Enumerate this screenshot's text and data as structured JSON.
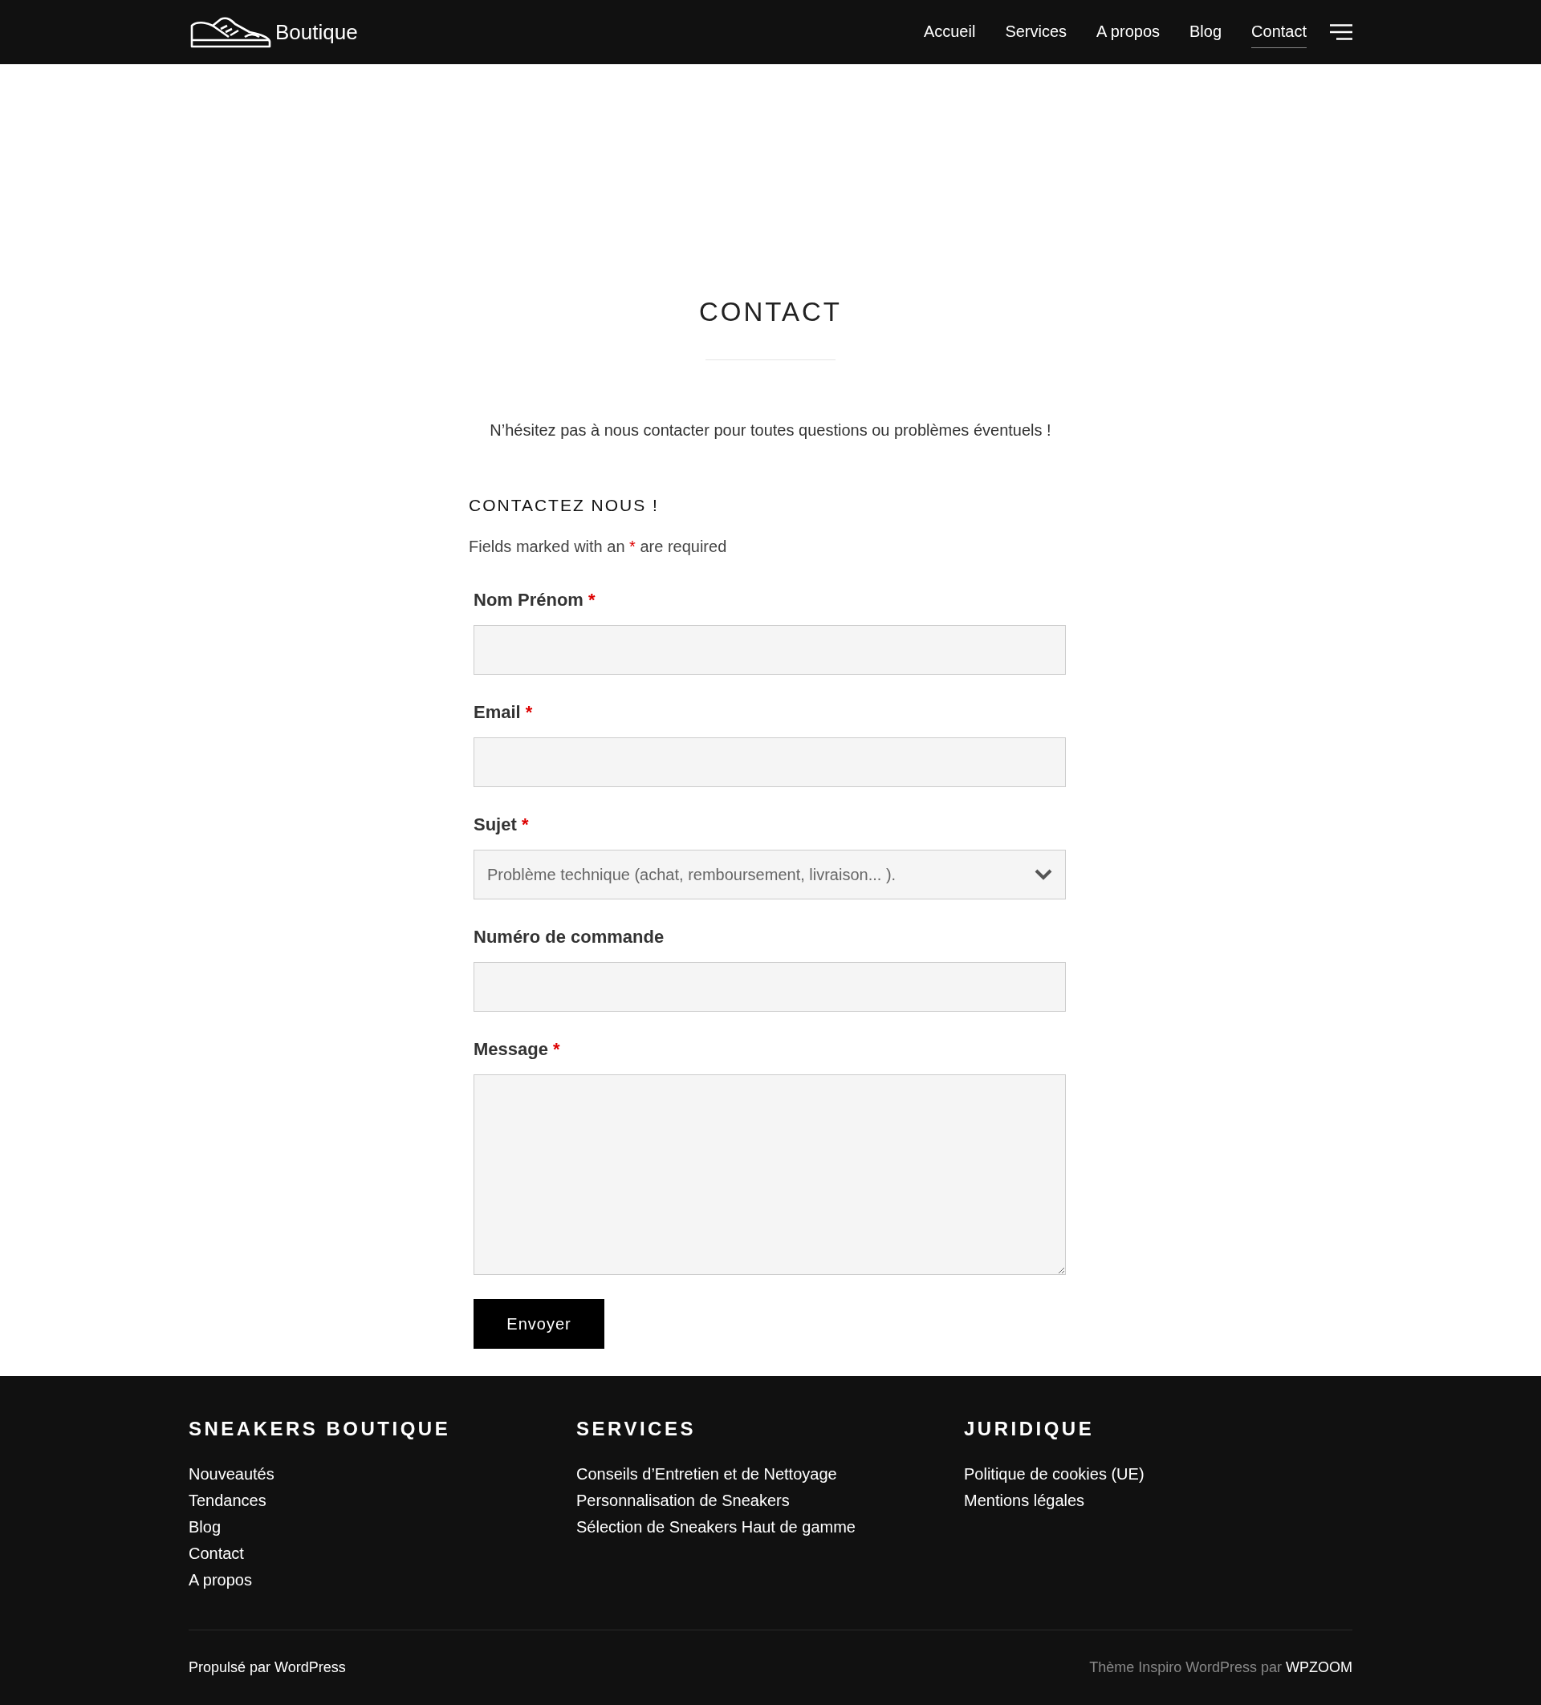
{
  "header": {
    "brand": "Boutique",
    "nav": [
      {
        "label": "Accueil",
        "selected": false
      },
      {
        "label": "Services",
        "selected": false
      },
      {
        "label": "A propos",
        "selected": false
      },
      {
        "label": "Blog",
        "selected": false
      },
      {
        "label": "Contact",
        "selected": true
      }
    ]
  },
  "page": {
    "title": "CONTACT",
    "intro": "N’hésitez pas à nous contacter pour toutes questions ou problèmes éventuels !"
  },
  "form": {
    "title": "CONTACTEZ NOUS !",
    "required_note": {
      "before": "Fields marked with an",
      "mark": "*",
      "after": "are required"
    },
    "fields": [
      {
        "kind": "text",
        "label": "Nom Prénom",
        "required": true
      },
      {
        "kind": "text",
        "label": "Email",
        "required": true
      },
      {
        "kind": "select",
        "label": "Sujet",
        "required": true,
        "value": "Problème technique (achat, remboursement, livraison... )."
      },
      {
        "kind": "text",
        "label": "Numéro de commande",
        "required": false
      },
      {
        "kind": "textarea",
        "label": "Message",
        "required": true
      }
    ],
    "submit": "Envoyer"
  },
  "footer": {
    "columns": [
      {
        "title": "SNEAKERS BOUTIQUE",
        "links": [
          "Nouveautés",
          "Tendances",
          "Blog",
          "Contact",
          "A propos"
        ]
      },
      {
        "title": "SERVICES",
        "links": [
          "Conseils d’Entretien et de Nettoyage",
          "Personnalisation de Sneakers",
          "Sélection de Sneakers Haut de gamme"
        ]
      },
      {
        "title": "JURIDIQUE",
        "links": [
          "Politique de cookies (UE)",
          "Mentions légales"
        ]
      }
    ],
    "powered": "Propulsé par WordPress",
    "theme_credit": "Thème Inspiro WordPress par",
    "theme_author": "WPZOOM"
  }
}
